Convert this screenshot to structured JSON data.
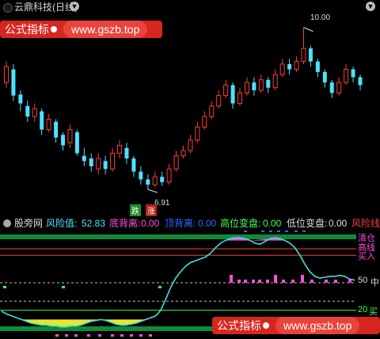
{
  "window": {
    "title": "云鼎科技(日线)"
  },
  "chart_data": [
    {
      "type": "candlestick",
      "title": "云鼎科技(日线)",
      "annotations": [
        {
          "text": "10.00",
          "kind": "high"
        },
        {
          "text": "6.91",
          "kind": "low"
        },
        {
          "text": "跌",
          "kind": "signal"
        },
        {
          "text": "涨",
          "kind": "signal"
        }
      ],
      "candles": [
        {
          "o": 8.95,
          "c": 9.25,
          "h": 9.35,
          "l": 8.85,
          "up": true
        },
        {
          "o": 9.2,
          "c": 8.7,
          "h": 9.3,
          "l": 8.6,
          "up": false
        },
        {
          "o": 8.72,
          "c": 8.55,
          "h": 8.8,
          "l": 8.4,
          "up": false
        },
        {
          "o": 8.5,
          "c": 8.3,
          "h": 8.6,
          "l": 8.2,
          "up": false
        },
        {
          "o": 8.3,
          "c": 8.45,
          "h": 8.55,
          "l": 8.2,
          "up": true
        },
        {
          "o": 8.4,
          "c": 8.05,
          "h": 8.45,
          "l": 7.95,
          "up": false
        },
        {
          "o": 8.05,
          "c": 8.25,
          "h": 8.35,
          "l": 8.0,
          "up": true
        },
        {
          "o": 8.2,
          "c": 7.9,
          "h": 8.25,
          "l": 7.8,
          "up": false
        },
        {
          "o": 7.95,
          "c": 7.75,
          "h": 8.0,
          "l": 7.65,
          "up": false
        },
        {
          "o": 7.8,
          "c": 8.05,
          "h": 8.15,
          "l": 7.7,
          "up": true
        },
        {
          "o": 8.0,
          "c": 7.6,
          "h": 8.05,
          "l": 7.55,
          "up": false
        },
        {
          "o": 7.55,
          "c": 7.45,
          "h": 7.7,
          "l": 7.35,
          "up": false
        },
        {
          "o": 7.5,
          "c": 7.35,
          "h": 7.6,
          "l": 7.25,
          "up": false
        },
        {
          "o": 7.3,
          "c": 7.5,
          "h": 7.6,
          "l": 7.2,
          "up": true
        },
        {
          "o": 7.45,
          "c": 7.3,
          "h": 7.55,
          "l": 7.2,
          "up": false
        },
        {
          "o": 7.3,
          "c": 7.6,
          "h": 7.7,
          "l": 7.25,
          "up": true
        },
        {
          "o": 7.6,
          "c": 7.75,
          "h": 7.85,
          "l": 7.5,
          "up": true
        },
        {
          "o": 7.7,
          "c": 7.5,
          "h": 7.8,
          "l": 7.4,
          "up": false
        },
        {
          "o": 7.5,
          "c": 7.25,
          "h": 7.55,
          "l": 7.15,
          "up": false
        },
        {
          "o": 7.25,
          "c": 7.1,
          "h": 7.35,
          "l": 7.0,
          "up": false
        },
        {
          "o": 7.1,
          "c": 7.0,
          "h": 7.2,
          "l": 6.91,
          "up": false
        },
        {
          "o": 7.0,
          "c": 7.15,
          "h": 7.25,
          "l": 6.95,
          "up": true
        },
        {
          "o": 7.15,
          "c": 7.05,
          "h": 7.25,
          "l": 6.98,
          "up": false
        },
        {
          "o": 7.05,
          "c": 7.3,
          "h": 7.4,
          "l": 7.0,
          "up": true
        },
        {
          "o": 7.3,
          "c": 7.55,
          "h": 7.65,
          "l": 7.25,
          "up": true
        },
        {
          "o": 7.55,
          "c": 7.65,
          "h": 7.75,
          "l": 7.5,
          "up": true
        },
        {
          "o": 7.65,
          "c": 7.85,
          "h": 7.95,
          "l": 7.6,
          "up": true
        },
        {
          "o": 7.85,
          "c": 8.1,
          "h": 8.2,
          "l": 7.8,
          "up": true
        },
        {
          "o": 8.1,
          "c": 8.3,
          "h": 8.4,
          "l": 8.05,
          "up": true
        },
        {
          "o": 8.3,
          "c": 8.5,
          "h": 8.6,
          "l": 8.25,
          "up": true
        },
        {
          "o": 8.5,
          "c": 8.7,
          "h": 8.8,
          "l": 8.45,
          "up": true
        },
        {
          "o": 8.7,
          "c": 8.9,
          "h": 9.0,
          "l": 8.65,
          "up": true
        },
        {
          "o": 8.9,
          "c": 8.55,
          "h": 8.95,
          "l": 8.45,
          "up": false
        },
        {
          "o": 8.55,
          "c": 8.75,
          "h": 8.85,
          "l": 8.5,
          "up": true
        },
        {
          "o": 8.75,
          "c": 8.95,
          "h": 9.05,
          "l": 8.7,
          "up": true
        },
        {
          "o": 8.95,
          "c": 8.8,
          "h": 9.05,
          "l": 8.7,
          "up": false
        },
        {
          "o": 8.8,
          "c": 9.0,
          "h": 9.1,
          "l": 8.75,
          "up": true
        },
        {
          "o": 9.0,
          "c": 8.85,
          "h": 9.05,
          "l": 8.75,
          "up": false
        },
        {
          "o": 8.85,
          "c": 9.1,
          "h": 9.2,
          "l": 8.8,
          "up": true
        },
        {
          "o": 9.1,
          "c": 9.3,
          "h": 9.4,
          "l": 9.05,
          "up": true
        },
        {
          "o": 9.3,
          "c": 9.2,
          "h": 9.4,
          "l": 9.1,
          "up": false
        },
        {
          "o": 9.2,
          "c": 9.35,
          "h": 9.45,
          "l": 9.15,
          "up": true
        },
        {
          "o": 9.35,
          "c": 9.6,
          "h": 10.0,
          "l": 9.3,
          "up": true
        },
        {
          "o": 9.6,
          "c": 9.35,
          "h": 9.65,
          "l": 9.25,
          "up": false
        },
        {
          "o": 9.35,
          "c": 9.15,
          "h": 9.4,
          "l": 9.05,
          "up": false
        },
        {
          "o": 9.15,
          "c": 8.95,
          "h": 9.2,
          "l": 8.85,
          "up": false
        },
        {
          "o": 8.95,
          "c": 8.75,
          "h": 9.0,
          "l": 8.65,
          "up": false
        },
        {
          "o": 8.75,
          "c": 8.95,
          "h": 9.05,
          "l": 8.7,
          "up": true
        },
        {
          "o": 8.95,
          "c": 9.2,
          "h": 9.3,
          "l": 8.9,
          "up": true
        },
        {
          "o": 9.2,
          "c": 9.05,
          "h": 9.25,
          "l": 8.95,
          "up": false
        },
        {
          "o": 9.05,
          "c": 8.9,
          "h": 9.1,
          "l": 8.8,
          "up": false
        }
      ]
    },
    {
      "type": "line",
      "title": "股旁网",
      "values": {
        "风险值": "52.83",
        "底背离": "0.00",
        "顶背离": "0.00",
        "高位变盘": "0.00",
        "低位变盘": "0.00"
      },
      "right_labels": [
        "风险线",
        "清仓",
        "高线",
        "买入",
        "50 中",
        "20 买",
        "安全"
      ],
      "ylim": [
        0,
        100
      ],
      "levels": [
        100,
        80,
        50,
        30,
        20,
        0
      ],
      "series": [
        {
          "name": "风险值",
          "values": [
            19,
            16,
            14,
            12,
            10,
            8,
            6,
            5,
            4,
            4,
            3,
            3,
            2,
            2,
            3,
            3,
            4,
            6,
            8,
            9,
            10,
            9,
            7,
            5,
            4,
            4,
            5,
            6,
            8,
            10,
            12,
            14,
            20,
            32,
            45,
            55,
            62,
            68,
            72,
            74,
            76,
            78,
            82,
            88,
            93,
            96,
            98,
            99,
            99,
            98,
            96,
            93,
            92,
            95,
            98,
            99,
            98,
            96,
            93,
            88,
            80,
            70,
            62,
            57,
            55,
            56,
            57,
            57,
            58,
            57,
            54,
            52.83
          ]
        }
      ]
    }
  ],
  "panel2": {
    "name": "股旁网",
    "k1": "风险值:",
    "v1": "52.83",
    "k2": "底背离:",
    "v2": "0.00",
    "k3": "顶背离:",
    "v3": "0.00",
    "k4": "高位变盘:",
    "v4": "0.00",
    "k5": "低位变盘:",
    "v5": "0.00",
    "k6": "风险线"
  },
  "right_labels": {
    "r1": "清仓",
    "r2": "高线",
    "r3": "买入",
    "r4": "50",
    "r5": "中",
    "r6": "20",
    "r7": "买",
    "r8": "安全"
  },
  "banner": {
    "name": "公式指标",
    "url": "www.gszb.top"
  },
  "price_labels": {
    "high": "10.00",
    "low": "6.91"
  },
  "signals": {
    "down": "跌",
    "up": "涨"
  },
  "colors": {
    "up": "#ff3b3b",
    "down": "#4fe0ff",
    "risk": "#40e0e0",
    "accent": "#d7261f"
  }
}
